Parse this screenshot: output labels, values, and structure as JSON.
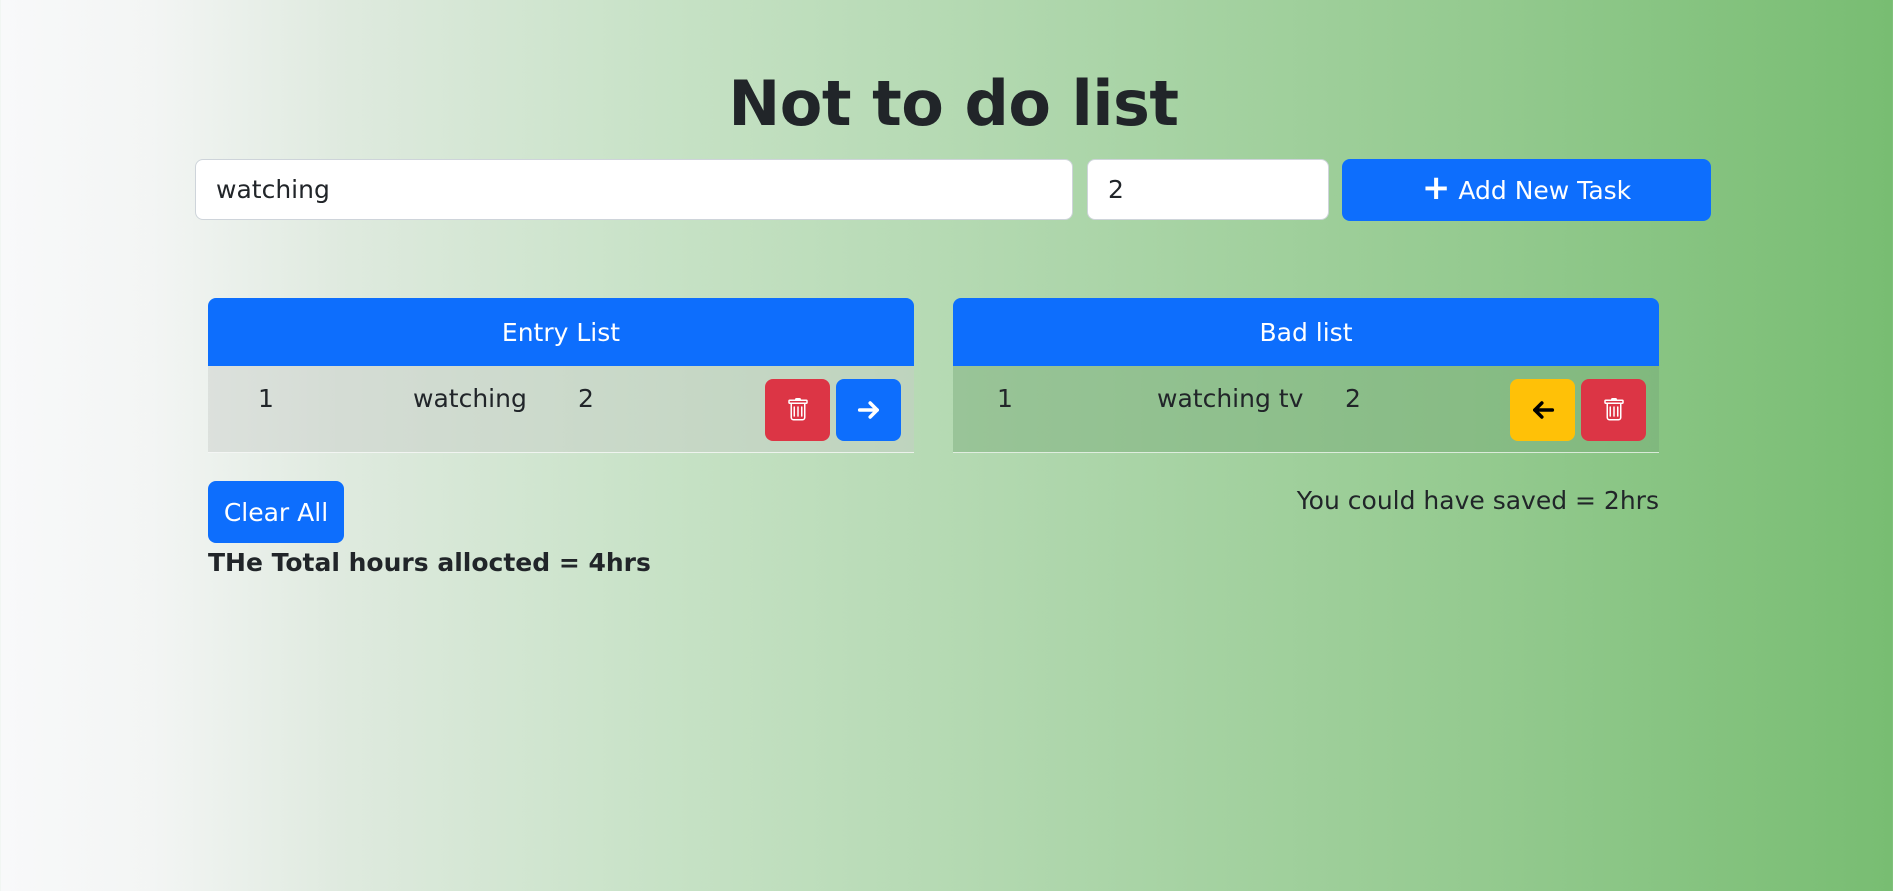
{
  "header": {
    "title": "Not to do list"
  },
  "form": {
    "task_value": "watching",
    "hours_value": "2",
    "add_button_label": "Add New Task"
  },
  "entry_list": {
    "title": "Entry List",
    "rows": [
      {
        "index": "1",
        "task": "watching",
        "hours": "2"
      }
    ]
  },
  "bad_list": {
    "title": "Bad list",
    "rows": [
      {
        "index": "1",
        "task": "watching tv",
        "hours": "2"
      }
    ]
  },
  "footer": {
    "clear_label": "Clear All",
    "total_text": "THe Total hours allocted = 4hrs",
    "saved_text": "You could have saved = 2hrs"
  },
  "colors": {
    "primary": "#0d6efd",
    "danger": "#dc3545",
    "warning": "#ffc107"
  },
  "icons": {
    "add": "plus-icon",
    "delete": "trash-icon",
    "move_right": "arrow-right-icon",
    "move_left": "arrow-left-icon"
  }
}
